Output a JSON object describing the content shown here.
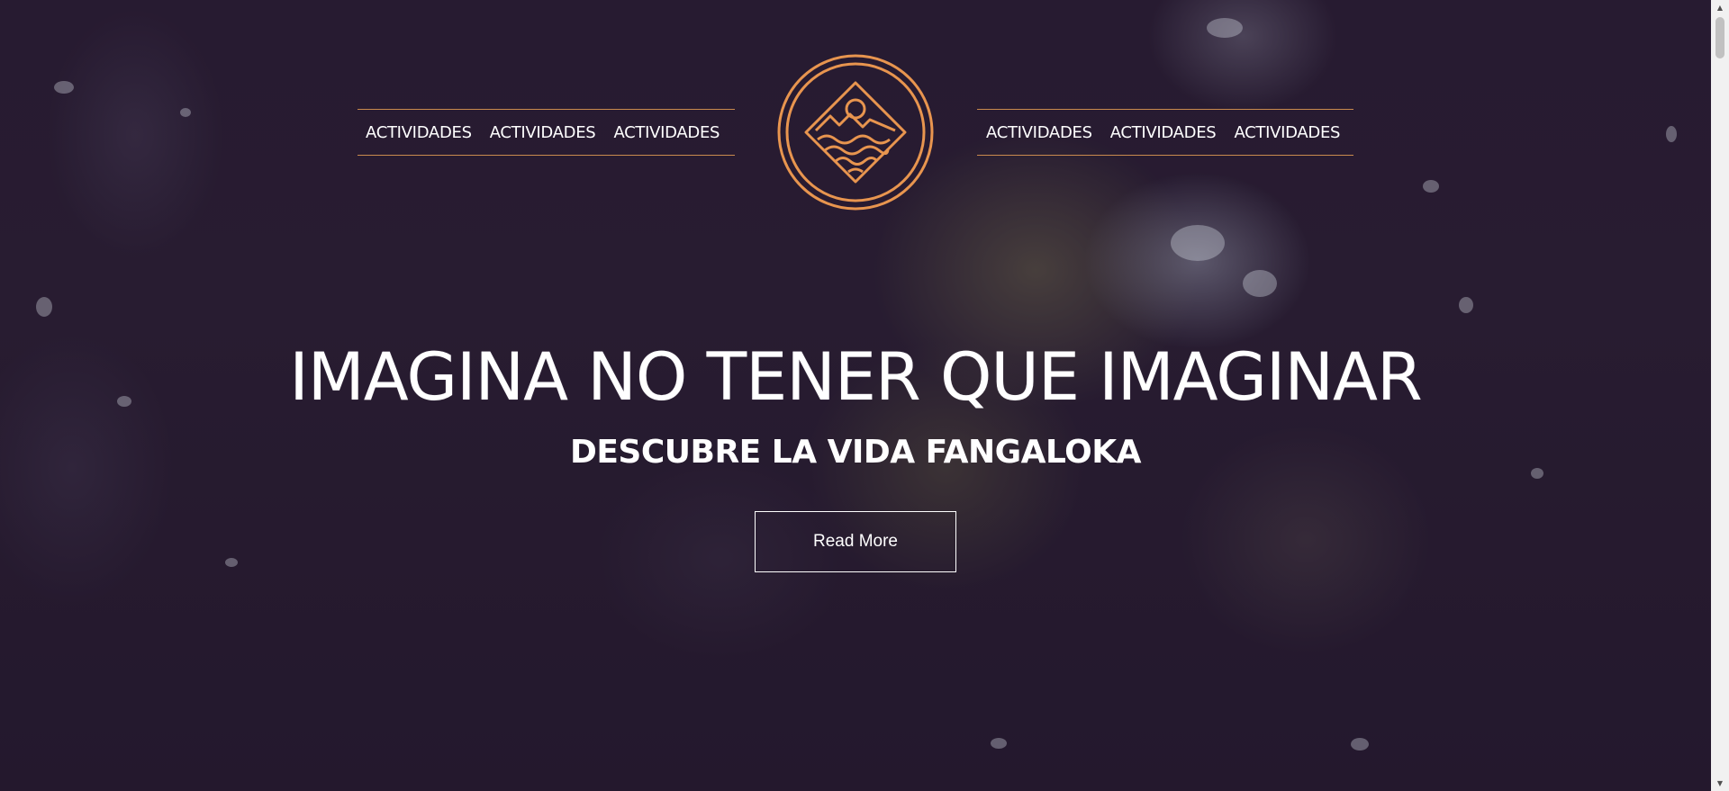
{
  "nav": {
    "left": [
      "ACTIVIDADES",
      "ACTIVIDADES",
      "ACTIVIDADES"
    ],
    "right": [
      "ACTIVIDADES",
      "ACTIVIDADES",
      "ACTIVIDADES"
    ]
  },
  "hero": {
    "headline": "IMAGINA NO TENER QUE IMAGINAR",
    "subheadline": "DESCUBRE LA VIDA FANGALOKA",
    "button_label": "Read More"
  },
  "colors": {
    "accent": "#e8954f",
    "nav_border": "#c98a4e",
    "overlay": "#241a2c",
    "text": "#ffffff"
  },
  "icons": {
    "logo": "sun-mountain-waves-logo-icon",
    "scroll_up": "triangle-up-icon",
    "scroll_down": "triangle-down-icon"
  }
}
